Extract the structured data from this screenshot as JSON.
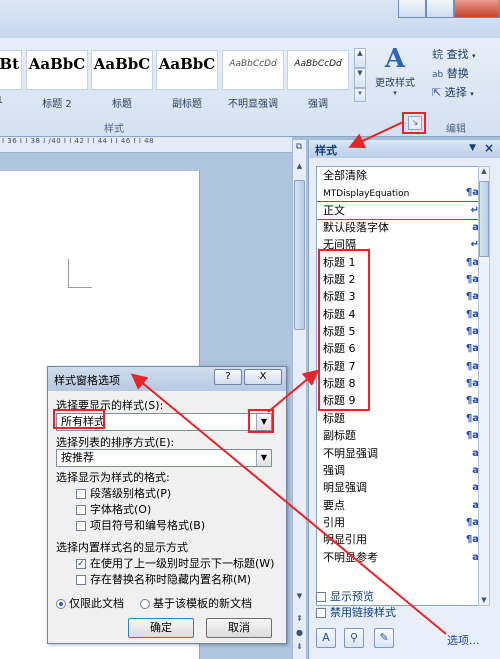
{
  "ribbon": {
    "styles_gallery": [
      {
        "sample": "Bt",
        "label": "1"
      },
      {
        "sample": "AaBbC",
        "label": "标题 2"
      },
      {
        "sample": "AaBbC",
        "label": "标题"
      },
      {
        "sample": "AaBbC",
        "label": "副标题"
      },
      {
        "sample": "AaBbCcDd",
        "label": "不明显强调"
      },
      {
        "sample": "AaBbCcDd",
        "label": "强调"
      }
    ],
    "change_styles_label": "更改样式",
    "find_label": "查找",
    "replace_label": "替换",
    "select_label": "选择",
    "styles_group_label": "样式",
    "editing_group_label": "编辑"
  },
  "ruler": {
    "text": "I 36 I  I 38 I  /40 I  I 42 I  I 44 I  I 46 I  I 48"
  },
  "styles_pane": {
    "title": "样式",
    "items": [
      {
        "name": "全部清除",
        "marker": ""
      },
      {
        "name": "MTDisplayEquation",
        "marker": "¶a"
      },
      {
        "name": "正文",
        "marker": "↵"
      },
      {
        "name": "默认段落字体",
        "marker": "a"
      },
      {
        "name": "无间隔",
        "marker": "↵"
      },
      {
        "name": "标题 1",
        "marker": "¶a"
      },
      {
        "name": "标题 2",
        "marker": "¶a"
      },
      {
        "name": "标题 3",
        "marker": "¶a"
      },
      {
        "name": "标题 4",
        "marker": "¶a"
      },
      {
        "name": "标题 5",
        "marker": "¶a"
      },
      {
        "name": "标题 6",
        "marker": "¶a"
      },
      {
        "name": "标题 7",
        "marker": "¶a"
      },
      {
        "name": "标题 8",
        "marker": "¶a"
      },
      {
        "name": "标题 9",
        "marker": "¶a"
      },
      {
        "name": "标题",
        "marker": "¶a"
      },
      {
        "name": "副标题",
        "marker": "¶a"
      },
      {
        "name": "不明显强调",
        "marker": "a"
      },
      {
        "name": "强调",
        "marker": "a"
      },
      {
        "name": "明显强调",
        "marker": "a"
      },
      {
        "name": "要点",
        "marker": "a"
      },
      {
        "name": "引用",
        "marker": "¶a"
      },
      {
        "name": "明显引用",
        "marker": "¶a"
      },
      {
        "name": "不明显参考",
        "marker": "a"
      }
    ],
    "show_preview_label": "显示预览",
    "disable_linked_label": "禁用链接样式",
    "options_link": "选项..."
  },
  "dialog": {
    "title": "样式窗格选项",
    "help_btn": "?",
    "close_btn": "X",
    "styles_to_show_label": "选择要显示的样式(S):",
    "styles_to_show_value": "所有样式",
    "sort_label": "选择列表的排序方式(E):",
    "sort_value": "按推荐",
    "format_group_label": "选择显示为样式的格式:",
    "paragraph_level": "段落级别格式(P)",
    "font_format": "字体格式(O)",
    "bullet_format": "项目符号和编号格式(B)",
    "builtin_group_label": "选择内置样式名的显示方式",
    "show_next_heading": "在使用了上一级别时显示下一标题(W)",
    "hide_builtin": "存在替换名称时隐藏内置名称(M)",
    "only_this_doc": "仅限此文档",
    "new_docs": "基于该模板的新文档",
    "ok_label": "确定",
    "cancel_label": "取消"
  }
}
